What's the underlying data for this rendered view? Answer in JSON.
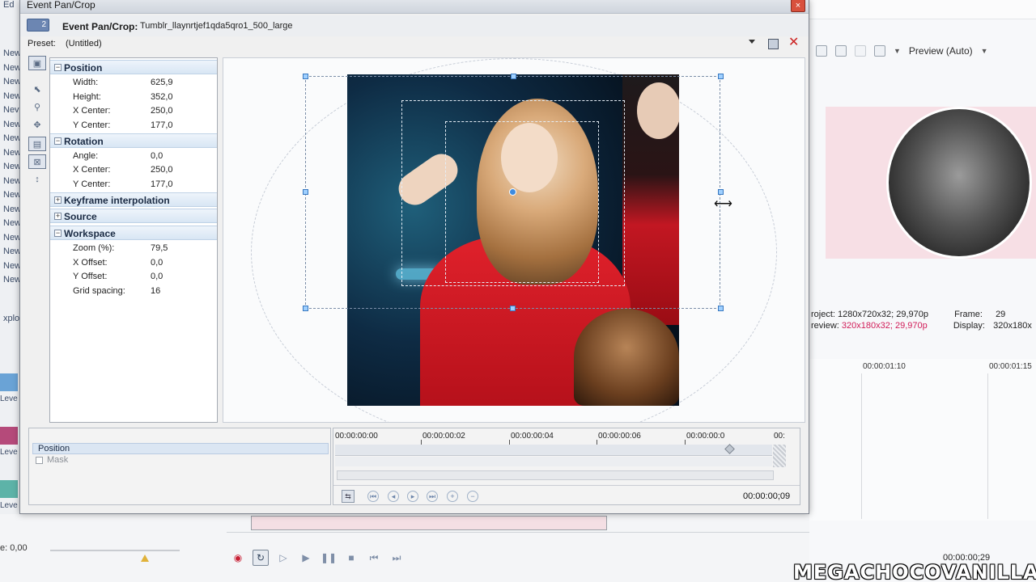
{
  "dialog": {
    "window_title": "Event Pan/Crop",
    "header_label": "Event Pan/Crop:",
    "file_name": "Tumblr_llaynrtjef1qda5qro1_500_large",
    "header_icon_text": "2",
    "preset_label": "Preset:",
    "preset_value": "(Untitled)",
    "close_glyph": "×",
    "delete_glyph": "✕"
  },
  "properties": {
    "position": {
      "title": "Position",
      "toggle": "−",
      "rows": [
        {
          "name": "Width:",
          "value": "625,9"
        },
        {
          "name": "Height:",
          "value": "352,0"
        },
        {
          "name": "X Center:",
          "value": "250,0"
        },
        {
          "name": "Y Center:",
          "value": "177,0"
        }
      ]
    },
    "rotation": {
      "title": "Rotation",
      "toggle": "−",
      "rows": [
        {
          "name": "Angle:",
          "value": "0,0"
        },
        {
          "name": "X Center:",
          "value": "250,0"
        },
        {
          "name": "Y Center:",
          "value": "177,0"
        }
      ]
    },
    "keyframe": {
      "title": "Keyframe interpolation",
      "toggle": "+"
    },
    "source": {
      "title": "Source",
      "toggle": "+"
    },
    "workspace": {
      "title": "Workspace",
      "toggle": "−",
      "rows": [
        {
          "name": "Zoom (%):",
          "value": "79,5"
        },
        {
          "name": "X Offset:",
          "value": "0,0"
        },
        {
          "name": "Y Offset:",
          "value": "0,0"
        },
        {
          "name": "Grid spacing:",
          "value": "16"
        }
      ]
    }
  },
  "keyframes": {
    "track_position": "Position",
    "track_mask": "Mask",
    "ticks": [
      "00:00:00:00",
      "00:00:00:02",
      "00:00:00:04",
      "00:00:00:06",
      "00:00:00:0",
      "00:"
    ],
    "current_time": "00:00:00;09"
  },
  "background": {
    "left_items": [
      "Ed",
      "New",
      "New",
      "New",
      "New",
      "Nev",
      "New",
      "New",
      "New",
      "New",
      "New",
      "New",
      "New",
      "New",
      "New",
      "New",
      "New",
      "New"
    ],
    "left_explorer": "xplo",
    "levels": [
      "Leve",
      "Leve",
      "Leve"
    ],
    "preview_label": "Preview (Auto)",
    "project_label": "roject:",
    "project_value": "1280x720x32; 29,970p",
    "preview_label2": "review:",
    "preview_value": "320x180x32; 29,970p",
    "frame_label": "Frame:",
    "frame_value": "29",
    "display_label": "Display:",
    "display_value": "320x180x",
    "timeline_ticks": [
      "00:00:01:10",
      "00:00:01:15"
    ],
    "rate_label": "e: 0,00",
    "time_right": "00:00:00;29",
    "watermark": "MEGACHOCOVANILLA"
  },
  "colors": {
    "accent": "#3d8be0",
    "section_header": "#d8e6f4",
    "close_red": "#d8503d",
    "record_red": "#c81f34",
    "pink_text": "#d11c58"
  }
}
